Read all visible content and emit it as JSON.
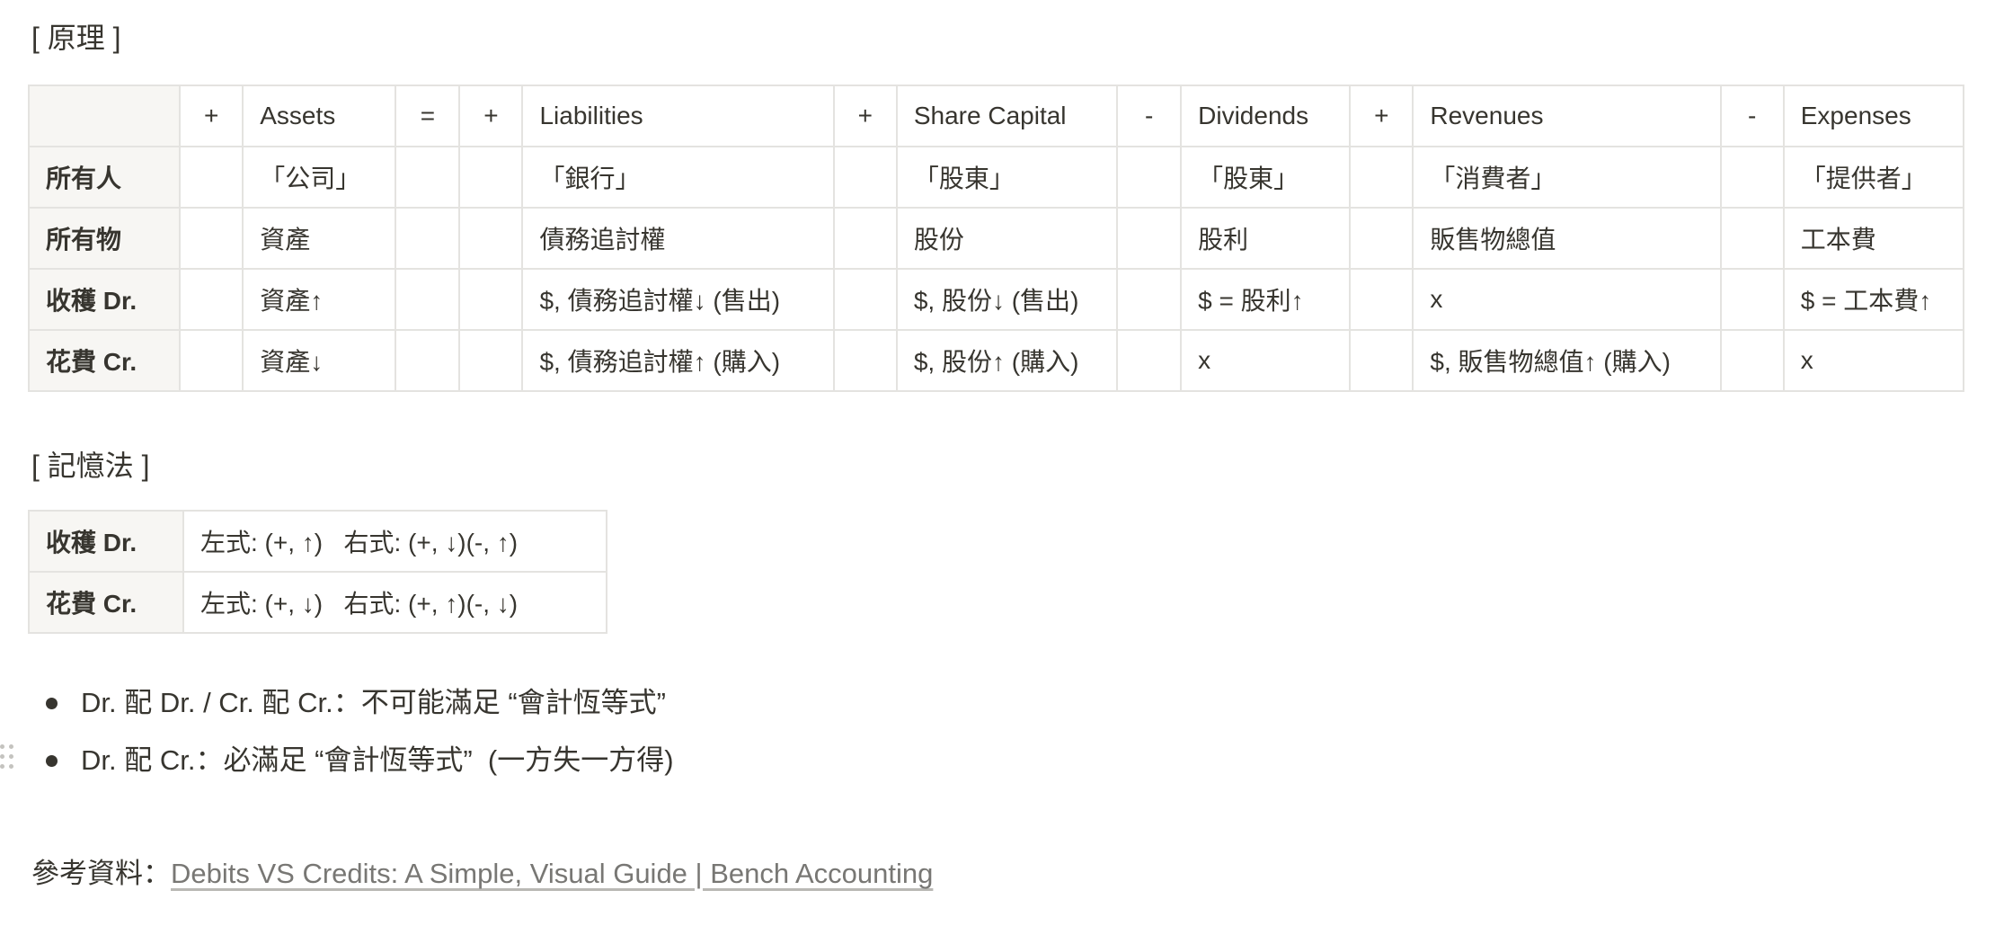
{
  "principle": {
    "heading": "[ 原理 ]",
    "header": [
      "",
      "+",
      "Assets",
      "=",
      "+",
      "Liabilities",
      "+",
      "Share Capital",
      "-",
      "Dividends",
      "+",
      "Revenues",
      "-",
      "Expenses"
    ],
    "rows": [
      [
        "所有人",
        "",
        "「公司」",
        "",
        "",
        "「銀行」",
        "",
        "「股東」",
        "",
        "「股東」",
        "",
        "「消費者」",
        "",
        "「提供者」"
      ],
      [
        "所有物",
        "",
        "資產",
        "",
        "",
        "債務追討權",
        "",
        "股份",
        "",
        "股利",
        "",
        "販售物總值",
        "",
        "工本費"
      ],
      [
        "收穫 Dr.",
        "",
        "資產↑",
        "",
        "",
        "$, 債務追討權↓ (售出)",
        "",
        "$, 股份↓ (售出)",
        "",
        "$ = 股利↑",
        "",
        "x",
        "",
        "$ = 工本費↑"
      ],
      [
        "花費 Cr.",
        "",
        "資產↓",
        "",
        "",
        "$, 債務追討權↑ (購入)",
        "",
        "$, 股份↑ (購入)",
        "",
        "x",
        "",
        "$, 販售物總值↑ (購入)",
        "",
        "x"
      ]
    ]
  },
  "mnemonic": {
    "heading": "[ 記憶法 ]",
    "rows": [
      [
        "收穫 Dr.",
        "左式: (+, ↑)   右式: (+, ↓)(-, ↑)"
      ],
      [
        "花費 Cr.",
        "左式: (+, ↓)   右式: (+, ↑)(-, ↓)"
      ]
    ]
  },
  "bullets": [
    "Dr. 配 Dr. / Cr. 配 Cr.：不可能滿足 “會計恆等式”",
    "Dr. 配 Cr.：必滿足 “會計恆等式”  (一方失一方得)"
  ],
  "reference": {
    "label": "參考資料：",
    "link_text": "Debits VS Credits: A Simple, Visual Guide | Bench Accounting"
  }
}
